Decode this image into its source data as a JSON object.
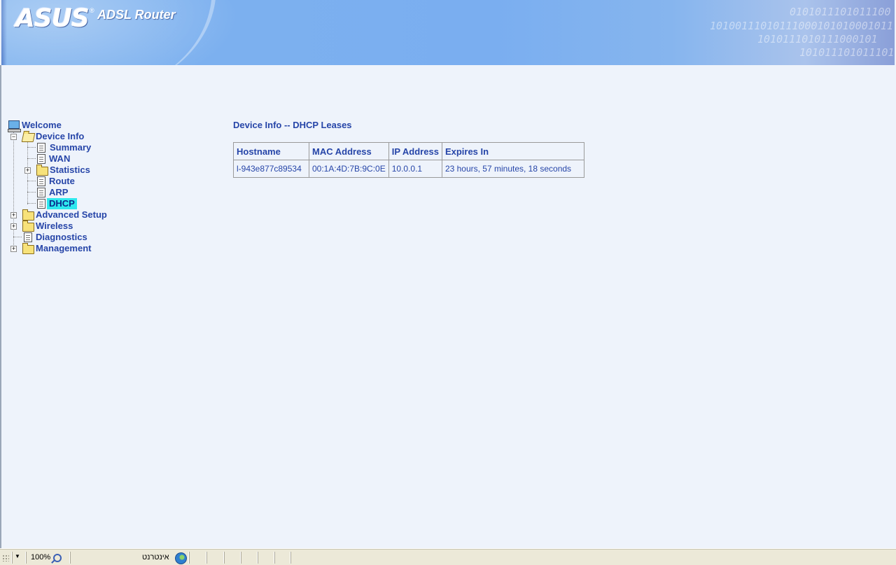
{
  "header": {
    "logo_text": "ASUS",
    "logo_mark": "®",
    "product_name": "ADSL Router",
    "binary_lines": [
      "0101011101011100",
      "10100111010111000101010001011",
      "1010111010111000101",
      "1010111010111011"
    ]
  },
  "menu": {
    "welcome": "Welcome",
    "device_info": "Device Info",
    "summary": "Summary",
    "wan": "WAN",
    "statistics": "Statistics",
    "route": "Route",
    "arp": "ARP",
    "dhcp": "DHCP",
    "advanced_setup": "Advanced Setup",
    "wireless": "Wireless",
    "diagnostics": "Diagnostics",
    "management": "Management",
    "expand_symbol": "+",
    "collapse_symbol": "−"
  },
  "content": {
    "title": "Device Info -- DHCP Leases",
    "table": {
      "headers": {
        "hostname": "Hostname",
        "mac": "MAC Address",
        "ip": "IP Address",
        "expires": "Expires In"
      },
      "rows": [
        {
          "hostname": "l-943e877c89534",
          "mac": "00:1A:4D:7B:9C:0E",
          "ip": "10.0.0.1",
          "expires": "23 hours, 57 minutes, 18 seconds"
        }
      ]
    }
  },
  "statusbar": {
    "zoom": "100%",
    "zoom_arrow": "▼",
    "zone": "אינטרנט"
  },
  "colors": {
    "link_text": "#2645a8",
    "selected_highlight": "#2ee8ee",
    "page_background": "#eef3fb"
  }
}
